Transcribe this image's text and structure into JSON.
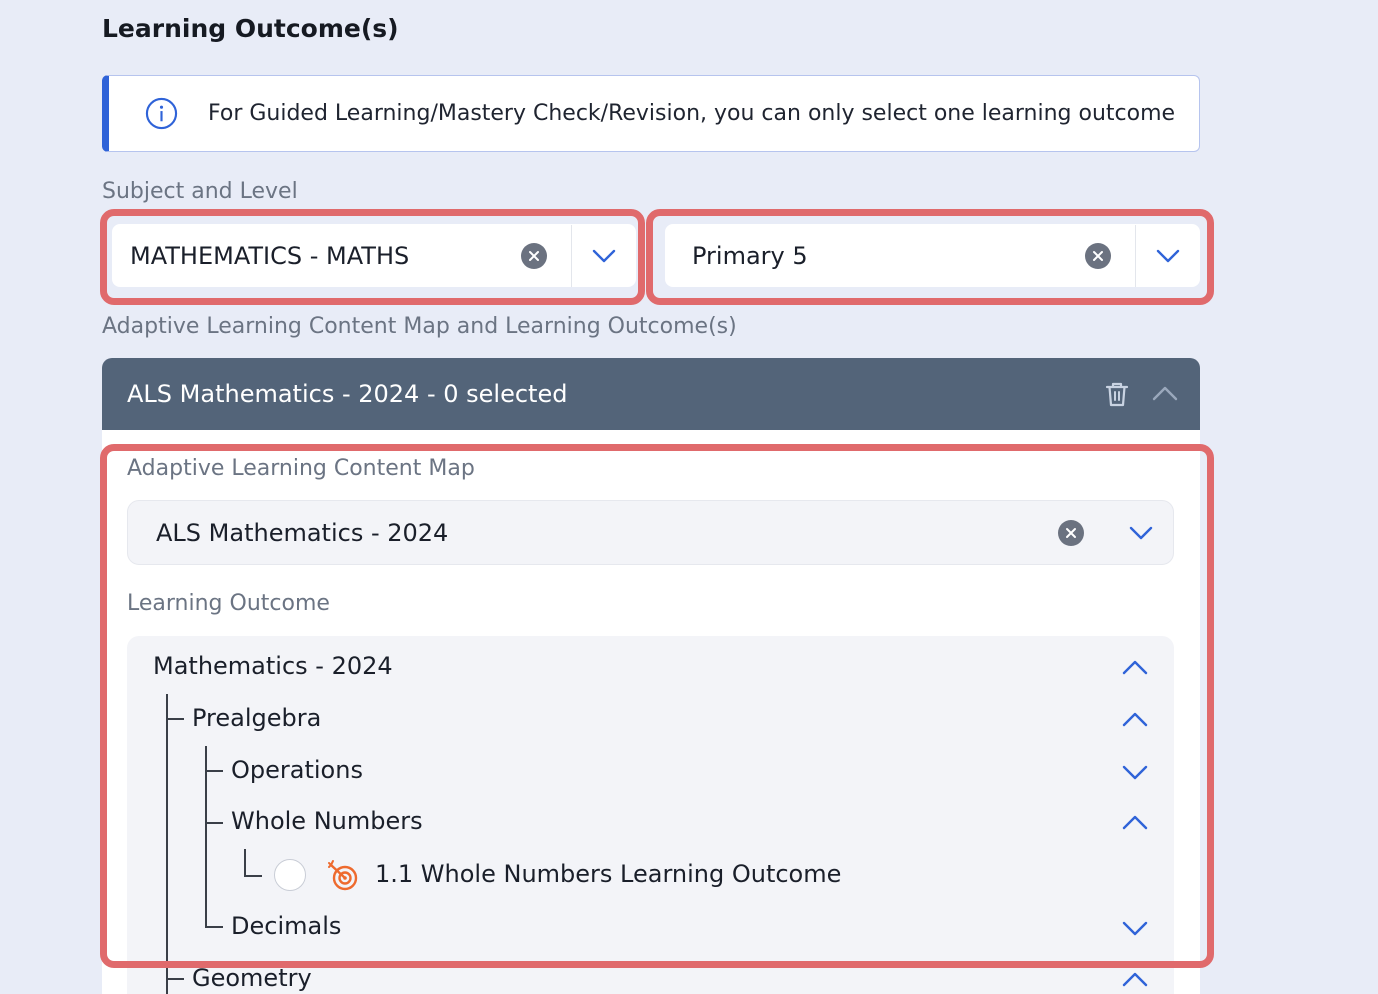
{
  "section": {
    "title": "Learning Outcome(s)"
  },
  "info_banner": {
    "icon": "info-icon",
    "text": "For Guided Learning/Mastery Check/Revision, you can only select one learning outcome",
    "accent_color": "#2f63d8"
  },
  "subject_level": {
    "label": "Subject and Level",
    "subject": {
      "value": "MATHEMATICS - MATHS"
    },
    "level": {
      "value": "Primary 5"
    }
  },
  "content_map_section": {
    "label": "Adaptive Learning Content Map and Learning Outcome(s)",
    "card": {
      "title": "ALS Mathematics - 2024 - 0 selected",
      "header_color": "#536479",
      "map_label": "Adaptive Learning Content Map",
      "map_value": "ALS Mathematics - 2024",
      "outcome_label": "Learning Outcome",
      "tree": {
        "root": "Mathematics - 2024",
        "prealgebra": "Prealgebra",
        "operations": "Operations",
        "whole_numbers": "Whole Numbers",
        "outcome_item": "1.1 Whole Numbers Learning Outcome",
        "decimals": "Decimals",
        "geometry": "Geometry"
      }
    }
  },
  "highlight_color": "#e06a6c"
}
